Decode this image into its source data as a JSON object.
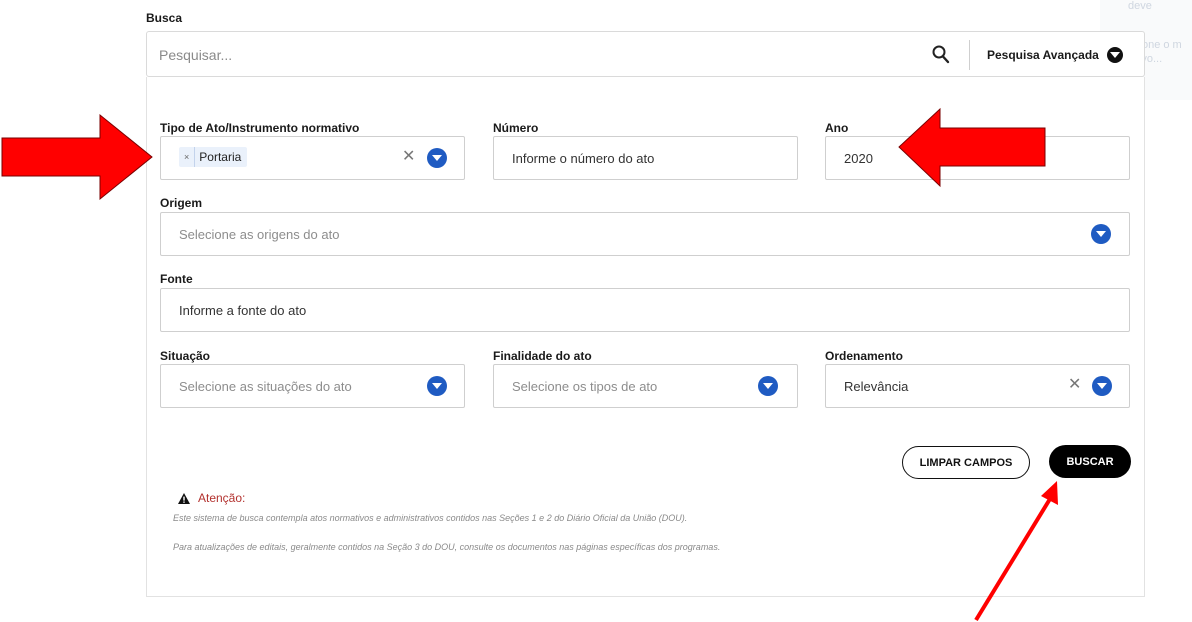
{
  "search": {
    "section_label": "Busca",
    "placeholder": "Pesquisar...",
    "advanced_label": "Pesquisa Avançada"
  },
  "ghost": {
    "top": "deve",
    "line1": "Selecione o m",
    "line2": "do Novo..."
  },
  "form": {
    "tipo": {
      "label": "Tipo de Ato/Instrumento normativo",
      "tag": "Portaria",
      "tag_remove": "×",
      "clear": "✕"
    },
    "numero": {
      "label": "Número",
      "placeholder": "Informe o número do ato"
    },
    "ano": {
      "label": "Ano",
      "value": "2020"
    },
    "origem": {
      "label": "Origem",
      "placeholder": "Selecione as origens do ato"
    },
    "fonte": {
      "label": "Fonte",
      "placeholder": "Informe a fonte do ato"
    },
    "situacao": {
      "label": "Situação",
      "placeholder": "Selecione as situações do ato"
    },
    "finalidade": {
      "label": "Finalidade do ato",
      "placeholder": "Selecione os tipos de ato"
    },
    "ordenamento": {
      "label": "Ordenamento",
      "value": "Relevância",
      "clear": "✕"
    }
  },
  "buttons": {
    "clear": "LIMPAR CAMPOS",
    "search": "BUSCAR"
  },
  "notice": {
    "title": "Atenção:",
    "line1": "Este sistema de busca contempla atos normativos e administrativos contidos nas Seções 1 e 2 do Diário Oficial da União (DOU).",
    "line2": "Para atualizações de editais, geralmente contidos na Seção 3 do DOU, consulte os documentos nas páginas específicas dos programas."
  },
  "colors": {
    "accent_blue": "#1f5bc2",
    "annotation_red": "#ff0000",
    "warning_red": "#b3322f"
  },
  "icons": [
    "search-icon",
    "caret-down-icon",
    "close-icon",
    "warning-icon",
    "arrow-annotation"
  ]
}
